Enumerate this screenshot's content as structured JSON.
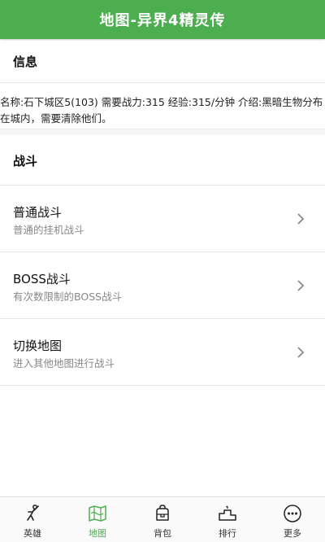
{
  "navbar": {
    "title": "地图-异界4精灵传"
  },
  "info": {
    "header": "信息",
    "text": "名称:石下城区5(103)  需要战力:315  经验:315/分钟  介绍:黑暗生物分布在城内，需要清除他们。"
  },
  "battle": {
    "header": "战斗",
    "items": [
      {
        "title": "普通战斗",
        "desc": "普通的挂机战斗"
      },
      {
        "title": "BOSS战斗",
        "desc": "有次数限制的BOSS战斗"
      },
      {
        "title": "切换地图",
        "desc": "进入其他地图进行战斗"
      }
    ]
  },
  "tabbar": {
    "active": "map",
    "tabs": [
      {
        "label": "英雄",
        "icon": "hero-icon"
      },
      {
        "label": "地图",
        "icon": "map-icon"
      },
      {
        "label": "背包",
        "icon": "bag-icon"
      },
      {
        "label": "排行",
        "icon": "rank-icon"
      },
      {
        "label": "更多",
        "icon": "more-icon"
      }
    ]
  },
  "colors": {
    "accent": "#4cae4f",
    "text": "#111111",
    "subtext": "#888888"
  }
}
